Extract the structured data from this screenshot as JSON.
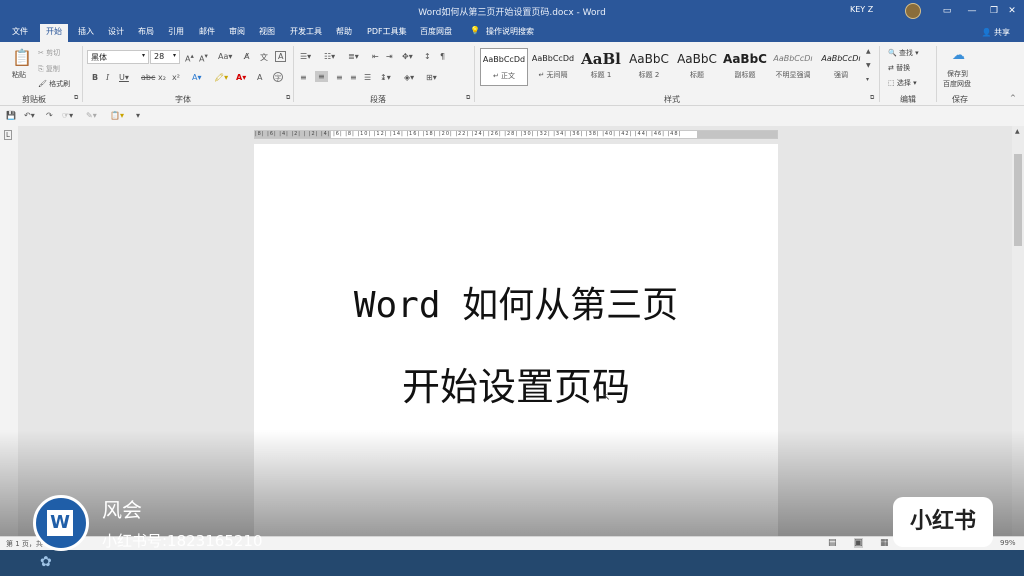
{
  "window": {
    "title": "Word如何从第三页开始设置页码.docx - Word",
    "user": "KEY Z",
    "min": "—",
    "restore": "❐",
    "close": "✕"
  },
  "tabs": [
    "文件",
    "开始",
    "插入",
    "设计",
    "布局",
    "引用",
    "邮件",
    "审阅",
    "视图",
    "开发工具",
    "帮助",
    "PDF工具集",
    "百度网盘"
  ],
  "search_tab": "操作说明搜索",
  "share": "共享",
  "ribbon": {
    "clipboard": {
      "paste": "粘贴",
      "cut": "剪切",
      "copy": "复制",
      "format_painter": "格式刷",
      "group": "剪贴板"
    },
    "font": {
      "name": "黑体",
      "size": "28",
      "group": "字体"
    },
    "paragraph": {
      "group": "段落"
    },
    "styles": {
      "group": "样式",
      "items": [
        {
          "preview": "AaBbCcDd",
          "name": "↵ 正文"
        },
        {
          "preview": "AaBbCcDd",
          "name": "↵ 无间隔"
        },
        {
          "preview": "AaBl",
          "name": "标题 1"
        },
        {
          "preview": "AaBbC",
          "name": "标题 2"
        },
        {
          "preview": "AaBbC",
          "name": "标题"
        },
        {
          "preview": "AaBbC",
          "name": "副标题"
        },
        {
          "preview": "AaBbCcDı",
          "name": "不明显强调"
        },
        {
          "preview": "AaBbCcDı",
          "name": "强调"
        }
      ]
    },
    "editing": {
      "find": "查找",
      "replace": "替换",
      "select": "选择",
      "group": "编辑"
    },
    "save": {
      "line1": "保存到",
      "line2": "百度网盘",
      "group": "保存"
    }
  },
  "ruler": {
    "marks": "|8| |6| |4| |2| |  |2| |4| |6| |8| |10| |12| |14| |16| |18| |20| |22| |24| |26| |28| |30| |32| |34| |36| |38| |40| |42| |44| |46| |48|"
  },
  "document": {
    "line1": "Word 如何从第三页",
    "line2": "开始设置页码"
  },
  "status": {
    "left": "第 1 页，共",
    "zoom": "99%"
  },
  "watermark": {
    "name": "风会",
    "id": "小红书号:1823165210",
    "badge": "小红书"
  }
}
